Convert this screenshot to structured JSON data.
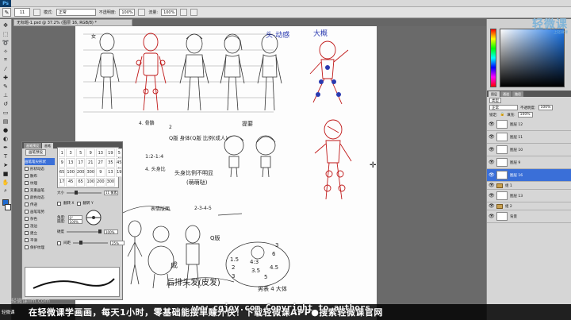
{
  "app": {
    "logo": "Ps"
  },
  "options_bar": {
    "brush_size": "11",
    "mode_label": "模式:",
    "mode_value": "正常",
    "opacity_label": "不透明度:",
    "opacity_value": "100%",
    "flow_label": "流量:",
    "flow_value": "100%"
  },
  "document_tab": "无标题-1.psd @ 37.2% (图层 16, RGB/8) *",
  "brush_panel": {
    "tabs": [
      "画笔预设",
      "画笔"
    ],
    "preset_button": "画笔预设",
    "items": [
      {
        "label": "画笔笔尖形状",
        "selected": true
      },
      {
        "label": "形状动态",
        "selected": false
      },
      {
        "label": "散布",
        "selected": false
      },
      {
        "label": "纹理",
        "selected": false
      },
      {
        "label": "双重画笔",
        "selected": false
      },
      {
        "label": "颜色动态",
        "selected": false
      },
      {
        "label": "传递",
        "selected": false
      },
      {
        "label": "画笔笔势",
        "selected": false
      },
      {
        "label": "杂色",
        "selected": false
      },
      {
        "label": "湿边",
        "selected": false
      },
      {
        "label": "建立",
        "selected": false
      },
      {
        "label": "平滑",
        "selected": false
      },
      {
        "label": "保护纹理",
        "selected": false
      }
    ],
    "size_label": "大小",
    "size_value": "11 像素",
    "flip_x": "翻转 X",
    "flip_y": "翻转 Y",
    "angle_label": "角度:",
    "angle_value": "0°",
    "roundness_label": "圆度:",
    "roundness_value": "100%",
    "hardness_label": "硬度",
    "hardness_value": "100%",
    "spacing_label": "间距",
    "spacing_value": "25%",
    "grid_sizes": [
      "1",
      "3",
      "5",
      "9",
      "13",
      "19",
      "5",
      "9",
      "13",
      "17",
      "21",
      "27",
      "35",
      "45",
      "65",
      "100",
      "200",
      "300",
      "9",
      "13",
      "19",
      "17",
      "45",
      "65",
      "100",
      "200",
      "300"
    ]
  },
  "navigator": {
    "logo_main": "轻微课",
    "logo_sub": "上轻微课"
  },
  "layers_panel": {
    "tabs": [
      "图层",
      "通道",
      "路径"
    ],
    "kind_label": "类型",
    "blend_mode": "正常",
    "opacity_label": "不透明度:",
    "opacity_value": "100%",
    "lock_label": "锁定:",
    "fill_label": "填充:",
    "fill_value": "100%",
    "layers": [
      {
        "name": "图层 12",
        "selected": false,
        "group": false
      },
      {
        "name": "图层 11",
        "selected": false,
        "group": false
      },
      {
        "name": "图层 10",
        "selected": false,
        "group": false
      },
      {
        "name": "图层 9",
        "selected": false,
        "group": false
      },
      {
        "name": "图层 16",
        "selected": true,
        "group": false
      },
      {
        "name": "组 1",
        "selected": false,
        "group": true
      },
      {
        "name": "图层 13",
        "selected": false,
        "group": false
      },
      {
        "name": "组 2",
        "selected": false,
        "group": true
      },
      {
        "name": "背景",
        "selected": false,
        "group": false
      }
    ]
  },
  "canvas_text": {
    "t1": "4. 骨骼",
    "t2": "2",
    "t3": "Q版 身体(Q版 比例(成人)",
    "t4": "1:2-1:4",
    "t5": "头身比例不明显",
    "t6": "(萌萌哒)",
    "t7": "4. 头身比",
    "t8": "提要",
    "t9": "后排头发(皮发)",
    "t10": "男表 4 大体",
    "t11": "表情版面",
    "t12": "成",
    "t13": "1.5",
    "t14": "2",
    "t15": "3",
    "t16": "4:3",
    "t17": "3.5",
    "t18": "4.5",
    "t19": "6",
    "t20": "3",
    "t21": "5",
    "t22": "Q版",
    "t23": "2-3-4-5",
    "t24": "头-动感",
    "t25": "大概",
    "t26": "女"
  },
  "subtitle": {
    "logo": "轻微课",
    "text": "在轻微课学画画，每天1小时，零基础能接单赚外快！下载轻微课APP●搜索轻微课官网",
    "watermark": "www.cgjoy.com Copyright to authors",
    "left_watermark": "轻微课lim.com"
  },
  "colors": {
    "accent": "#3a6fd8",
    "foreground_color": "#1e6ad0",
    "sketch_red": "#c01818",
    "sketch_blue": "#2a3ab0"
  }
}
